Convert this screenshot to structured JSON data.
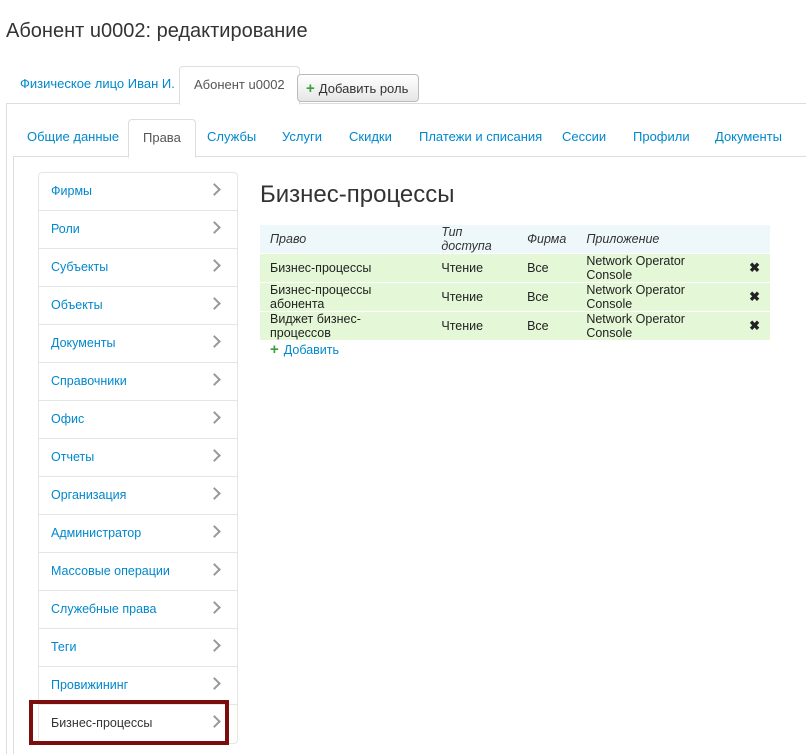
{
  "page": {
    "title": "Абонент u0002: редактирование"
  },
  "top_tabs": [
    {
      "label": "Физическое лицо Иван И.",
      "active": false
    },
    {
      "label": "Абонент u0002",
      "active": true
    }
  ],
  "add_role_label": "Добавить роль",
  "sub_tabs": [
    {
      "label": "Общие данные",
      "active": false
    },
    {
      "label": "Права",
      "active": true
    },
    {
      "label": "Службы",
      "active": false
    },
    {
      "label": "Услуги",
      "active": false
    },
    {
      "label": "Скидки",
      "active": false
    },
    {
      "label": "Платежи и списания",
      "active": false
    },
    {
      "label": "Сессии",
      "active": false
    },
    {
      "label": "Профили",
      "active": false
    },
    {
      "label": "Документы",
      "active": false
    }
  ],
  "sidebar": {
    "items": [
      {
        "label": "Фирмы"
      },
      {
        "label": "Роли"
      },
      {
        "label": "Субъекты"
      },
      {
        "label": "Объекты"
      },
      {
        "label": "Документы"
      },
      {
        "label": "Справочники"
      },
      {
        "label": "Офис"
      },
      {
        "label": "Отчеты"
      },
      {
        "label": "Организация"
      },
      {
        "label": "Администратор"
      },
      {
        "label": "Массовые операции"
      },
      {
        "label": "Служебные права"
      },
      {
        "label": "Теги"
      },
      {
        "label": "Провижининг"
      },
      {
        "label": "Бизнес-процессы"
      }
    ]
  },
  "main": {
    "title": "Бизнес-процессы",
    "columns": [
      "Право",
      "Тип доступа",
      "Фирма",
      "Приложение"
    ],
    "rows": [
      {
        "right": "Бизнес-процессы",
        "access": "Чтение",
        "firm": "Все",
        "app": "Network Operator Console"
      },
      {
        "right": "Бизнес-процессы абонента",
        "access": "Чтение",
        "firm": "Все",
        "app": "Network Operator Console"
      },
      {
        "right": "Виджет бизнес-процессов",
        "access": "Чтение",
        "firm": "Все",
        "app": "Network Operator Console"
      }
    ],
    "add_label": "Добавить"
  }
}
